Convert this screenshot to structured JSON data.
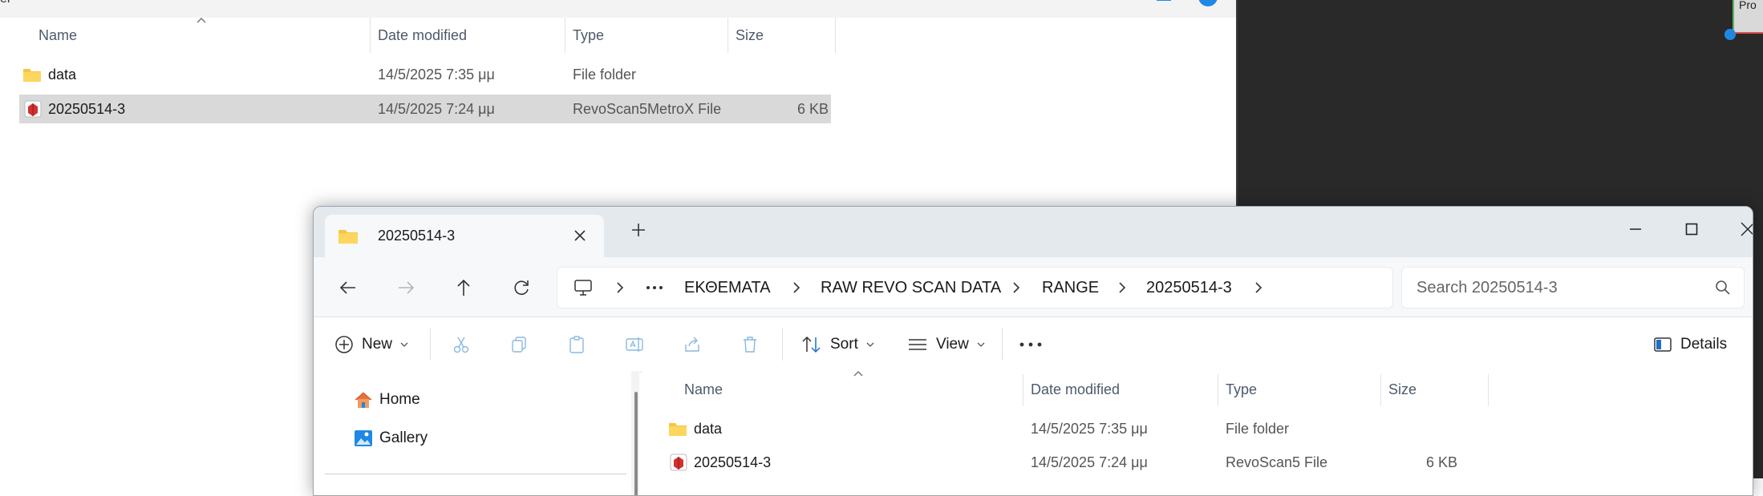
{
  "colors": {
    "folder": "#f8c53f",
    "accent_blue": "#1e88e5",
    "selection": "#d9d9d9",
    "dark_region": "#292929",
    "titlebar": "#e4e9ee"
  },
  "bg_window": {
    "title_fragment": "el",
    "columns": {
      "name": "Name",
      "date": "Date modified",
      "type": "Type",
      "size": "Size"
    },
    "rows": [
      {
        "icon": "folder-icon",
        "name": "data",
        "date": "14/5/2025 7:35 μμ",
        "type": "File folder",
        "size": "",
        "selected": false
      },
      {
        "icon": "revoscan-file-icon",
        "name": "20250514-3",
        "date": "14/5/2025 7:24 μμ",
        "type": "RevoScan5MetroX File",
        "size": "6 KB",
        "selected": true
      }
    ]
  },
  "corner_tile": {
    "label": "Pro"
  },
  "fg_window": {
    "tab": {
      "label": "20250514-3",
      "icon": "folder-icon"
    },
    "breadcrumb": [
      "ΕΚΘΕΜΑΤΑ",
      "RAW REVO SCAN DATA",
      "RANGE",
      "20250514-3"
    ],
    "search": {
      "placeholder": "Search 20250514-3"
    },
    "toolbar": {
      "new_label": "New",
      "sort_label": "Sort",
      "view_label": "View",
      "details_label": "Details"
    },
    "nav_pane": [
      {
        "label": "Home",
        "icon": "home-icon"
      },
      {
        "label": "Gallery",
        "icon": "gallery-icon"
      }
    ],
    "columns": {
      "name": "Name",
      "date": "Date modified",
      "type": "Type",
      "size": "Size"
    },
    "rows": [
      {
        "icon": "folder-icon",
        "name": "data",
        "date": "14/5/2025 7:35 μμ",
        "type": "File folder",
        "size": ""
      },
      {
        "icon": "revoscan-file-icon",
        "name": "20250514-3",
        "date": "14/5/2025 7:24 μμ",
        "type": "RevoScan5 File",
        "size": "6 KB"
      }
    ]
  }
}
